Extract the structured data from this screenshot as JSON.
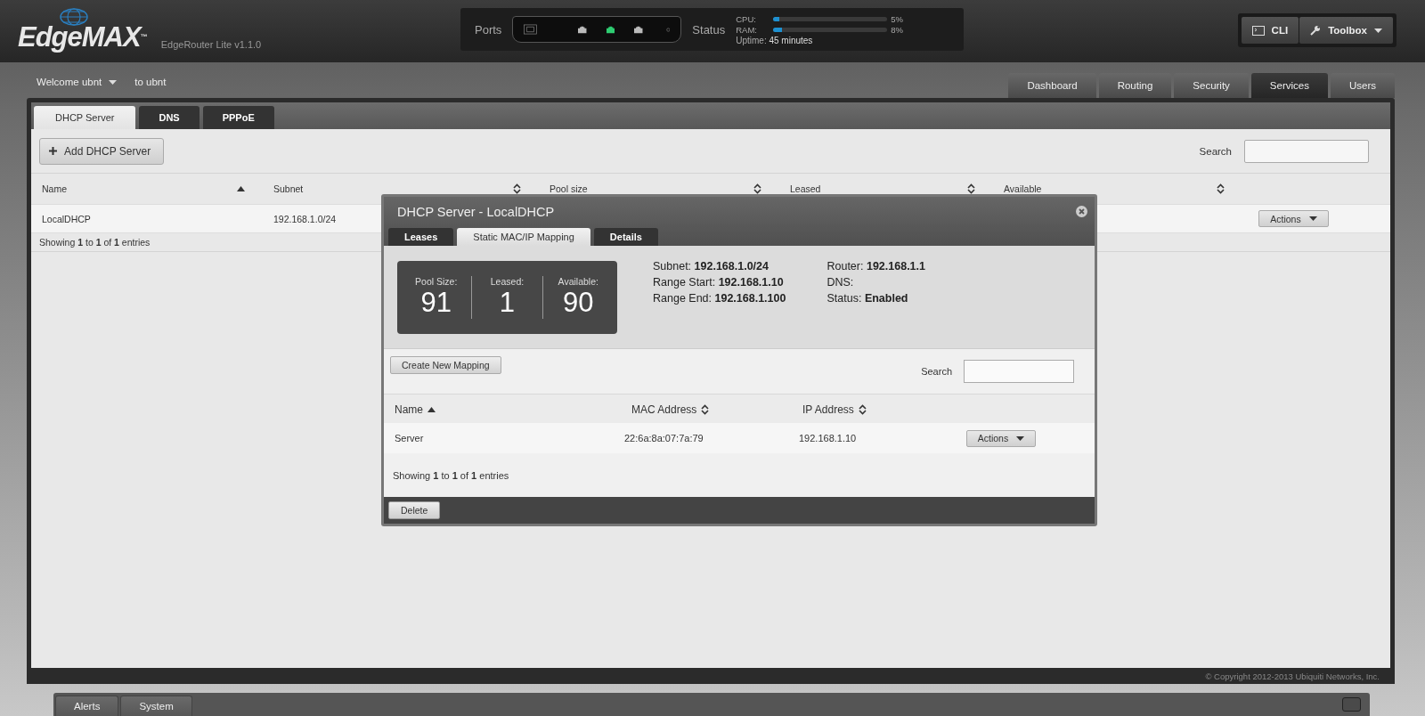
{
  "header": {
    "logo": "EdgeMAX$^{™}$",
    "model": "EdgeRouter Lite v1.1.0",
    "ports_label": "Ports",
    "ports": [
      {
        "kind": "console"
      },
      {
        "kind": "ethernet",
        "active": false
      },
      {
        "kind": "ethernet",
        "active": true
      },
      {
        "kind": "ethernet",
        "active": false
      },
      {
        "kind": "led"
      }
    ],
    "status_label": "Status",
    "meters": [
      {
        "label": "CPU:",
        "level": 0.05,
        "reading": "5%"
      },
      {
        "label": "RAM:",
        "level": 0.08,
        "reading": "8%"
      }
    ],
    "uptime_label": "Uptime:",
    "uptime": "45 minutes",
    "buttons": [
      {
        "kind": "terminal",
        "label": "CLI"
      },
      {
        "kind": "tools",
        "label": "Toolbox"
      }
    ]
  },
  "user_bar": {
    "welcome": "Welcome ubnt",
    "target": "to ubnt"
  },
  "nav_tabs": [
    {
      "label": "Dashboard",
      "selected": false
    },
    {
      "label": "Routing",
      "selected": false
    },
    {
      "label": "Security",
      "selected": false
    },
    {
      "label": "Services",
      "selected": true
    },
    {
      "label": "Users",
      "selected": false
    }
  ],
  "sub_tabs": [
    {
      "label": "DHCP Server",
      "selected": true
    },
    {
      "label": "DNS",
      "selected": false
    },
    {
      "label": "PPPoE",
      "selected": false
    }
  ],
  "toolbar": {
    "add_button": "Add DHCP Server",
    "search_label": "Search"
  },
  "table": {
    "columns": [
      {
        "label": "Name",
        "sorted": true
      },
      {
        "label": "Subnet",
        "sorted": false
      },
      {
        "label": "Pool size",
        "sorted": false
      },
      {
        "label": "Leased",
        "sorted": false
      },
      {
        "label": "Available",
        "sorted": false
      }
    ],
    "rows": [
      {
        "cells": [
          "LocalDHCP",
          "192.168.1.0/24"
        ],
        "action": "Actions"
      }
    ],
    "info": "Showing **1** to **1** of **1** entries"
  },
  "copyright": "© Copyright 2012-2013 Ubiquiti Networks, Inc.",
  "bottom_tabs": [
    "Alerts",
    "System"
  ],
  "dialog": {
    "title": "DHCP Server - LocalDHCP",
    "tabs": [
      {
        "label": "Leases",
        "selected": false
      },
      {
        "label": "Static MAC/IP Mapping",
        "selected": true
      },
      {
        "label": "Details",
        "selected": false
      }
    ],
    "stats": [
      {
        "label": "Pool Size:",
        "value": "91"
      },
      {
        "label": "Leased:",
        "value": "1"
      },
      {
        "label": "Available:",
        "value": "90"
      }
    ],
    "details": [
      [
        {
          "label": "Subnet:",
          "value": "192.168.1.0/24"
        },
        {
          "label": "Range Start:",
          "value": "192.168.1.10"
        },
        {
          "label": "Range End:",
          "value": "192.168.1.100"
        }
      ],
      [
        {
          "label": "Router:",
          "value": "192.168.1.1"
        },
        {
          "label": "DNS:"
        },
        {
          "label": "Status:",
          "value": "Enabled"
        }
      ]
    ],
    "create_button": "Create New Mapping",
    "search_label": "Search",
    "columns": [
      {
        "label": "Name",
        "sorted": true
      },
      {
        "label": "MAC Address",
        "sorted": false
      },
      {
        "label": "IP Address",
        "sorted": false
      }
    ],
    "rows": [
      {
        "cells": [
          "Server",
          "22:6a:8a:07:7a:79",
          "192.168.1.10"
        ],
        "action": "Actions"
      }
    ],
    "info": "Showing **1** to **1** of **1** entries",
    "delete_button": "Delete"
  }
}
